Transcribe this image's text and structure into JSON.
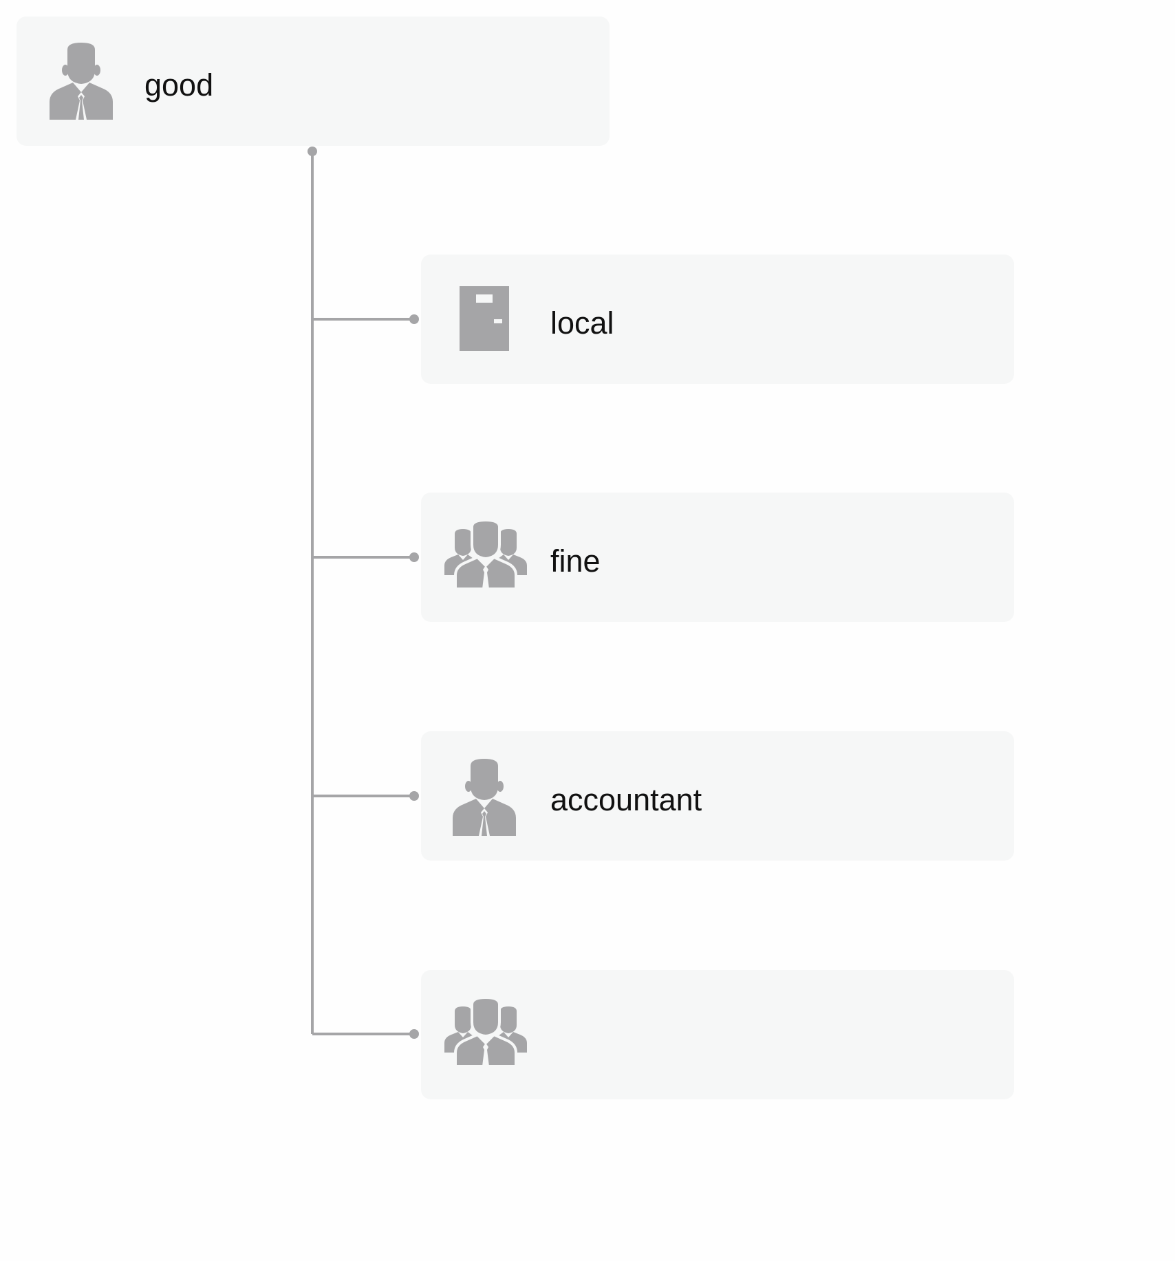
{
  "colors": {
    "node_background": "#f6f7f7",
    "connector": "#a5a5a7",
    "icon": "#a5a5a7",
    "text": "#111111"
  },
  "root": {
    "label": "good",
    "icon": "person-icon"
  },
  "children": [
    {
      "label": "local",
      "icon": "door-icon"
    },
    {
      "label": "fine",
      "icon": "group-icon"
    },
    {
      "label": "accountant",
      "icon": "person-icon"
    },
    {
      "label": "",
      "icon": "group-icon"
    }
  ]
}
